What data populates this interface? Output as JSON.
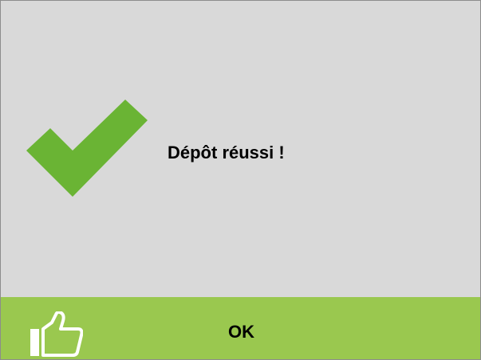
{
  "dialog": {
    "message": "Dépôt réussi !",
    "status_icon": "checkmark-icon",
    "status_color": "#6ab434"
  },
  "footer": {
    "ok_label": "OK",
    "icon": "thumbs-up-icon",
    "background": "#9ac84f"
  }
}
